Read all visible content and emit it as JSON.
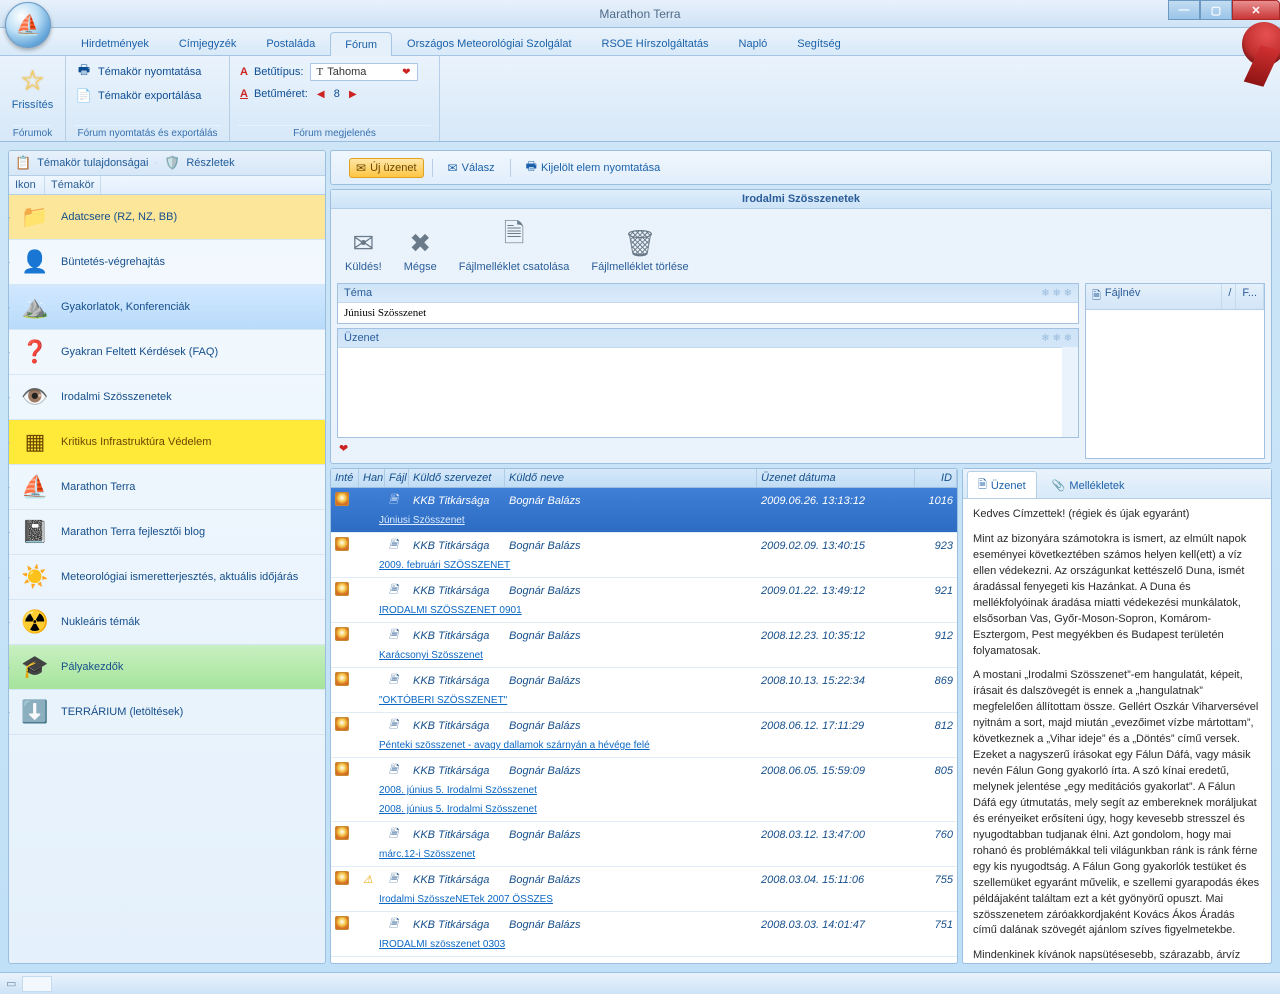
{
  "window": {
    "title": "Marathon Terra"
  },
  "tabs": [
    {
      "label": "Hirdetmények"
    },
    {
      "label": "Címjegyzék"
    },
    {
      "label": "Postaláda"
    },
    {
      "label": "Fórum",
      "active": true
    },
    {
      "label": "Országos Meteorológiai Szolgálat"
    },
    {
      "label": "RSOE Hírszolgáltatás"
    },
    {
      "label": "Napló"
    },
    {
      "label": "Segítség"
    }
  ],
  "ribbon": {
    "refresh": "Frissítés",
    "group1_label": "Fórumok",
    "print_topic": "Témakör nyomtatása",
    "export_topic": "Témakör exportálása",
    "group2_label": "Fórum nyomtatás és exportálás",
    "font_label": "Betűtípus:",
    "font_value": "Tahoma",
    "size_label": "Betűméret:",
    "size_value": "8",
    "group3_label": "Fórum megjelenés"
  },
  "left": {
    "header_props": "Témakör tulajdonságai",
    "header_details": "Részletek",
    "col_icon": "Ikon",
    "col_topic": "Témakör",
    "items": [
      {
        "label": "Adatcsere (RZ, NZ, BB)",
        "icon": "📁",
        "cls": "hover"
      },
      {
        "label": "Büntetés-végrehajtás",
        "icon": "👤"
      },
      {
        "label": "Gyakorlatok, Konferenciák",
        "icon": "⛰️",
        "cls": "sel"
      },
      {
        "label": "Gyakran Feltett Kérdések (FAQ)",
        "icon": "❓"
      },
      {
        "label": "Irodalmi Szösszenetek",
        "icon": "👁️"
      },
      {
        "label": "Kritikus Infrastruktúra Védelem",
        "icon": "▦",
        "cls": "yellow"
      },
      {
        "label": "Marathon Terra",
        "icon": "⛵"
      },
      {
        "label": "Marathon Terra fejlesztői blog",
        "icon": "📓"
      },
      {
        "label": "Meteorológiai ismeretterjesztés, aktuális időjárás",
        "icon": "☀️"
      },
      {
        "label": "Nukleáris témák",
        "icon": "☢️"
      },
      {
        "label": "Pályakezdők",
        "icon": "🎓",
        "cls": "green"
      },
      {
        "label": "TERRÁRIUM (letöltések)",
        "icon": "⬇️"
      }
    ]
  },
  "rtool": {
    "new": "Új üzenet",
    "reply": "Válasz",
    "print_sel": "Kijelölt elem nyomtatása"
  },
  "compose": {
    "band": "Irodalmi Szösszenetek",
    "send": "Küldés!",
    "cancel": "Mégse",
    "attach": "Fájlmelléklet csatolása",
    "del_attach": "Fájlmelléklet törlése",
    "topic_lbl": "Téma",
    "topic_val": "Júniusi Szösszenet",
    "msg_lbl": "Üzenet",
    "file_hdr": "Fájlnév",
    "file_col2": "F..."
  },
  "msgcols": {
    "a": "Inté",
    "b": "Han",
    "c": "Fájl",
    "org": "Küldő szervezet",
    "name": "Küldő neve",
    "date": "Üzenet dátuma",
    "id": "ID"
  },
  "messages": [
    {
      "org": "KKB Titkársága",
      "name": "Bognár Balázs",
      "date": "2009.06.26. 13:13:12",
      "id": "1016",
      "sub": "Júniusi Szösszenet",
      "sel": true,
      "fileico": true
    },
    {
      "org": "KKB Titkársága",
      "name": "Bognár Balázs",
      "date": "2009.02.09. 13:40:15",
      "id": "923",
      "sub": "2009. februári SZÖSSZENET",
      "fileico": true
    },
    {
      "org": "KKB Titkársága",
      "name": "Bognár Balázs",
      "date": "2009.01.22. 13:49:12",
      "id": "921",
      "sub": "IRODALMI SZÖSSZENET 0901",
      "fileico": true
    },
    {
      "org": "KKB Titkársága",
      "name": "Bognár Balázs",
      "date": "2008.12.23. 10:35:12",
      "id": "912",
      "sub": "Karácsonyi Szösszenet",
      "fileico": true
    },
    {
      "org": "KKB Titkársága",
      "name": "Bognár Balázs",
      "date": "2008.10.13. 15:22:34",
      "id": "869",
      "sub": "\"OKTÓBERI SZÖSSZENET\"",
      "fileico": true
    },
    {
      "org": "KKB Titkársága",
      "name": "Bognár Balázs",
      "date": "2008.06.12. 17:11:29",
      "id": "812",
      "sub": "Pénteki szösszenet - avagy dallamok szárnyán a hévége felé",
      "fileico": true
    },
    {
      "org": "KKB Titkársága",
      "name": "Bognár Balázs",
      "date": "2008.06.05. 15:59:09",
      "id": "805",
      "sub": "2008. június 5. Irodalmi Szösszenet\n2008. június 5. Irodalmi Szösszenet",
      "fileico": true
    },
    {
      "org": "KKB Titkársága",
      "name": "Bognár Balázs",
      "date": "2008.03.12. 13:47:00",
      "id": "760",
      "sub": "márc.12-i Szösszenet",
      "fileico": true
    },
    {
      "org": "KKB Titkársága",
      "name": "Bognár Balázs",
      "date": "2008.03.04. 15:11:06",
      "id": "755",
      "sub": "Irodalmi SzösszeNETek 2007 ÖSSZES",
      "warn": true,
      "fileico": true
    },
    {
      "org": "KKB Titkársága",
      "name": "Bognár Balázs",
      "date": "2008.03.03. 14:01:47",
      "id": "751",
      "sub": "IRODALMI szösszenet 0303",
      "fileico": true
    }
  ],
  "reader": {
    "tab1": "Üzenet",
    "tab2": "Mellékletek",
    "greeting": "Kedves Címzettek! (régiek és újak egyaránt)",
    "p1": "Mint az bizonyára számotokra is ismert, az elmúlt napok eseményei következtében számos helyen kell(ett) a víz ellen védekezni. Az országunkat kettészelő Duna, ismét áradással fenyegeti kis Hazánkat. A Duna és mellékfolyóinak áradása miatti védekezési munkálatok, elsősorban Vas, Győr-Moson-Sopron, Komárom-Esztergom, Pest megyékben és Budapest területén folyamatosak.",
    "p2": "A mostani „Irodalmi Szösszenet”-em hangulatát, képeit, írásait és dalszövegét is ennek a „hangulatnak” megfelelően állítottam össze. Gellért Oszkár Viharversével nyitnám a sort, majd miután „evezőimet vízbe mártottam”, következnek a „Vihar ideje” és a „Döntés” című versek. Ezeket a nagyszerű írásokat egy Fálun Dáfá, vagy másik nevén Fálun Gong gyakorló írta. A szó kínai eredetű, melynek jelentése „egy meditációs gyakorlat”. A Fálun Dáfá egy útmutatás, mely segít az embereknek moráljukat és erényeiket erősíteni úgy, hogy kevesebb stresszel és nyugodtabban tudjanak élni. Azt gondolom, hogy mai rohanó és problémákkal teli világunkban ránk is ránk férne egy kis nyugodtság. A Fálun Gong gyakorlók testüket és szellemüket egyaránt művelik, e szellemi gyarapodás ékes példájaként találtam ezt a két gyönyörű opuszt. Mai szösszenetem záróakkordjaként Kovács Ákos Áradás című dalának szövegét ajánlom szíves figyelmetekbe.",
    "p3": "Mindenkinek kívánok napsütésesebb, szárazabb, árvíz mentes napokat, a hétvégére jó pihenést!"
  }
}
